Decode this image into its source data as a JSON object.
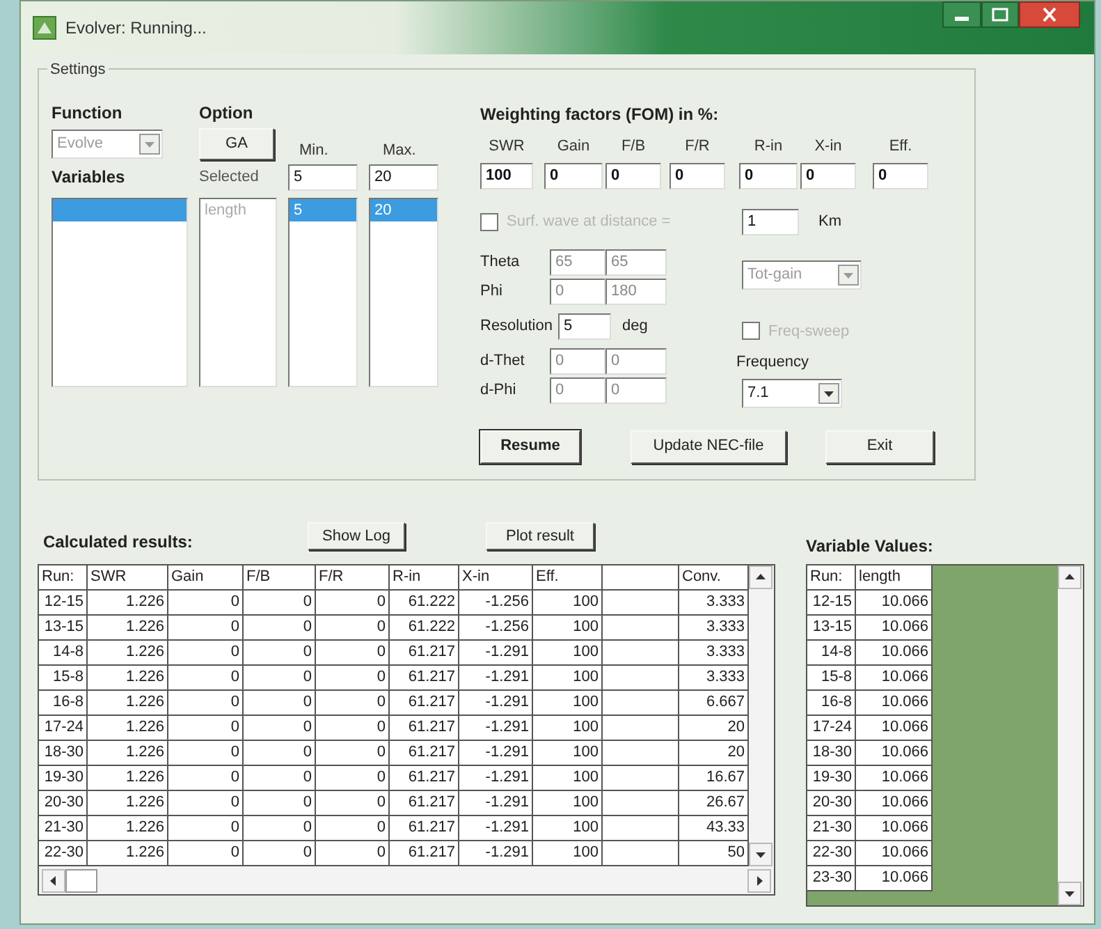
{
  "window": {
    "title": "Evolver: Running..."
  },
  "settings": {
    "title": "Settings",
    "function": {
      "label": "Function",
      "value": "Evolve",
      "disabled": true
    },
    "option": {
      "label": "Option",
      "button": "GA"
    },
    "variables": {
      "label": "Variables",
      "selected_label": "Selected",
      "min_label": "Min.",
      "max_label": "Max.",
      "min_value": "5",
      "max_value": "20",
      "rows": [
        {
          "name": "length",
          "min": "5",
          "max": "20",
          "selected": true
        }
      ]
    }
  },
  "weighting": {
    "title": "Weighting factors (FOM) in %:",
    "factors": [
      {
        "label": "SWR",
        "value": "100"
      },
      {
        "label": "Gain",
        "value": "0"
      },
      {
        "label": "F/B",
        "value": "0"
      },
      {
        "label": "F/R",
        "value": "0"
      },
      {
        "label": "R-in",
        "value": "0"
      },
      {
        "label": "X-in",
        "value": "0"
      },
      {
        "label": "Eff.",
        "value": "0"
      }
    ],
    "surface_wave": {
      "label": "Surf. wave at distance =",
      "checked": false,
      "disabled": true,
      "distance": "1",
      "unit": "Km"
    },
    "theta": {
      "label": "Theta",
      "values": [
        "65",
        "65"
      ]
    },
    "phi": {
      "label": "Phi",
      "values": [
        "0",
        "180"
      ]
    },
    "gain_type": {
      "value": "Tot-gain",
      "disabled": true
    },
    "resolution": {
      "label": "Resolution",
      "value": "5",
      "unit": "deg"
    },
    "freq_sweep": {
      "label": "Freq-sweep",
      "checked": false,
      "disabled": true
    },
    "d_theta": {
      "label": "d-Thet",
      "values": [
        "0",
        "0"
      ]
    },
    "d_phi": {
      "label": "d-Phi",
      "values": [
        "0",
        "0"
      ]
    },
    "frequency": {
      "label": "Frequency",
      "value": "7.1"
    },
    "buttons": [
      {
        "label": "Resume",
        "default": true
      },
      {
        "label": "Update NEC-file",
        "default": false
      },
      {
        "label": "Exit",
        "default": false
      }
    ]
  },
  "results": {
    "title": "Calculated results:",
    "show_log": "Show Log",
    "plot": "Plot result",
    "columns": [
      {
        "label": "Run:",
        "kind": "text"
      },
      {
        "label": "SWR",
        "kind": "text"
      },
      {
        "label": "Gain",
        "kind": "text"
      },
      {
        "label": "F/B",
        "kind": "text"
      },
      {
        "label": "F/R",
        "kind": "text"
      },
      {
        "label": "R-in",
        "kind": "text"
      },
      {
        "label": "X-in",
        "kind": "text"
      },
      {
        "label": "Eff.",
        "kind": "text"
      },
      {
        "kind": "blank"
      },
      {
        "label": "Conv.",
        "kind": "text"
      }
    ],
    "rows": [
      [
        "12-15",
        "1.226",
        "0",
        "0",
        "0",
        "61.222",
        "-1.256",
        "100",
        "3.333"
      ],
      [
        "13-15",
        "1.226",
        "0",
        "0",
        "0",
        "61.222",
        "-1.256",
        "100",
        "3.333"
      ],
      [
        "14-8",
        "1.226",
        "0",
        "0",
        "0",
        "61.217",
        "-1.291",
        "100",
        "3.333"
      ],
      [
        "15-8",
        "1.226",
        "0",
        "0",
        "0",
        "61.217",
        "-1.291",
        "100",
        "3.333"
      ],
      [
        "16-8",
        "1.226",
        "0",
        "0",
        "0",
        "61.217",
        "-1.291",
        "100",
        "6.667"
      ],
      [
        "17-24",
        "1.226",
        "0",
        "0",
        "0",
        "61.217",
        "-1.291",
        "100",
        "20"
      ],
      [
        "18-30",
        "1.226",
        "0",
        "0",
        "0",
        "61.217",
        "-1.291",
        "100",
        "20"
      ],
      [
        "19-30",
        "1.226",
        "0",
        "0",
        "0",
        "61.217",
        "-1.291",
        "100",
        "16.67"
      ],
      [
        "20-30",
        "1.226",
        "0",
        "0",
        "0",
        "61.217",
        "-1.291",
        "100",
        "26.67"
      ],
      [
        "21-30",
        "1.226",
        "0",
        "0",
        "0",
        "61.217",
        "-1.291",
        "100",
        "43.33"
      ],
      [
        "22-30",
        "1.226",
        "0",
        "0",
        "0",
        "61.217",
        "-1.291",
        "100",
        "50"
      ]
    ]
  },
  "variable_values": {
    "title": "Variable Values:",
    "columns": [
      "Run:",
      "length"
    ],
    "rows": [
      [
        "12-15",
        "10.066"
      ],
      [
        "13-15",
        "10.066"
      ],
      [
        "14-8",
        "10.066"
      ],
      [
        "15-8",
        "10.066"
      ],
      [
        "16-8",
        "10.066"
      ],
      [
        "17-24",
        "10.066"
      ],
      [
        "18-30",
        "10.066"
      ],
      [
        "19-30",
        "10.066"
      ],
      [
        "20-30",
        "10.066"
      ],
      [
        "21-30",
        "10.066"
      ],
      [
        "22-30",
        "10.066"
      ],
      [
        "23-30",
        "10.066"
      ]
    ]
  }
}
